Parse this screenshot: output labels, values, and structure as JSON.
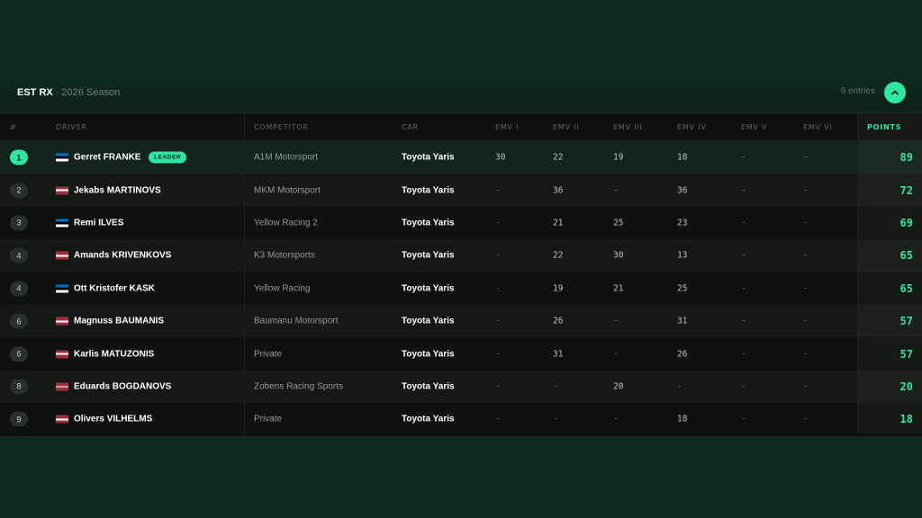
{
  "header": {
    "title": "EST RX",
    "separator": "·",
    "subtitle": "2026 Season",
    "entries": "9 entries",
    "collapse_icon": "chevron-up-icon"
  },
  "colors": {
    "accent": "#2ee6a0",
    "flag_estonia": [
      "#0072ce",
      "#000000",
      "#ffffff"
    ],
    "flag_latvia": [
      "#9e3039",
      "#ffffff",
      "#9e3039"
    ]
  },
  "columns": {
    "pos": "#",
    "driver": "DRIVER",
    "competitor": "COMPETITOR",
    "car": "CAR",
    "emv1": "EMV I",
    "emv2": "EMV II",
    "emv3": "EMV III",
    "emv4": "EMV IV",
    "emv5": "EMV V",
    "emv6": "EMV VI",
    "points": "POINTS"
  },
  "leader_badge": "LEADER",
  "rows": [
    {
      "pos": "1",
      "flag": "estonia",
      "driver": "Gerret FRANKE",
      "competitor": "A1M Motorsport",
      "car": "Toyota Yaris",
      "emv": [
        "30",
        "22",
        "19",
        "18",
        "-",
        "-"
      ],
      "points": "89"
    },
    {
      "pos": "2",
      "flag": "latvia",
      "driver": "Jekabs MARTINOVS",
      "competitor": "MKM Motorsport",
      "car": "Toyota Yaris",
      "emv": [
        "-",
        "36",
        "-",
        "36",
        "-",
        "-"
      ],
      "points": "72"
    },
    {
      "pos": "3",
      "flag": "estonia",
      "driver": "Remi ILVES",
      "competitor": "Yellow Racing 2",
      "car": "Toyota Yaris",
      "emv": [
        "-",
        "21",
        "25",
        "23",
        "-",
        "-"
      ],
      "points": "69"
    },
    {
      "pos": "4",
      "flag": "latvia",
      "driver": "Amands KRIVENKOVS",
      "competitor": "K3 Motorsports",
      "car": "Toyota Yaris",
      "emv": [
        "-",
        "22",
        "30",
        "13",
        "-",
        "-"
      ],
      "points": "65"
    },
    {
      "pos": "4",
      "flag": "estonia",
      "driver": "Ott Kristofer KASK",
      "competitor": "Yellow Racing",
      "car": "Toyota Yaris",
      "emv": [
        "-",
        "19",
        "21",
        "25",
        "-",
        "-"
      ],
      "points": "65"
    },
    {
      "pos": "6",
      "flag": "latvia",
      "driver": "Magnuss BAUMANIS",
      "competitor": "Baumanu Motorsport",
      "car": "Toyota Yaris",
      "emv": [
        "-",
        "26",
        "-",
        "31",
        "-",
        "-"
      ],
      "points": "57"
    },
    {
      "pos": "6",
      "flag": "latvia",
      "driver": "Karlis MATUZONIS",
      "competitor": "Private",
      "car": "Toyota Yaris",
      "emv": [
        "-",
        "31",
        "-",
        "26",
        "-",
        "-"
      ],
      "points": "57"
    },
    {
      "pos": "8",
      "flag": "latvia",
      "driver": "Eduards BOGDANOVS",
      "competitor": "Zobens Racing Sports",
      "car": "Toyota Yaris",
      "emv": [
        "-",
        "-",
        "20",
        "-",
        "-",
        "-"
      ],
      "points": "20"
    },
    {
      "pos": "9",
      "flag": "latvia",
      "driver": "Olivers VILHELMS",
      "competitor": "Private",
      "car": "Toyota Yaris",
      "emv": [
        "-",
        "-",
        "-",
        "18",
        "-",
        "-"
      ],
      "points": "18"
    }
  ]
}
